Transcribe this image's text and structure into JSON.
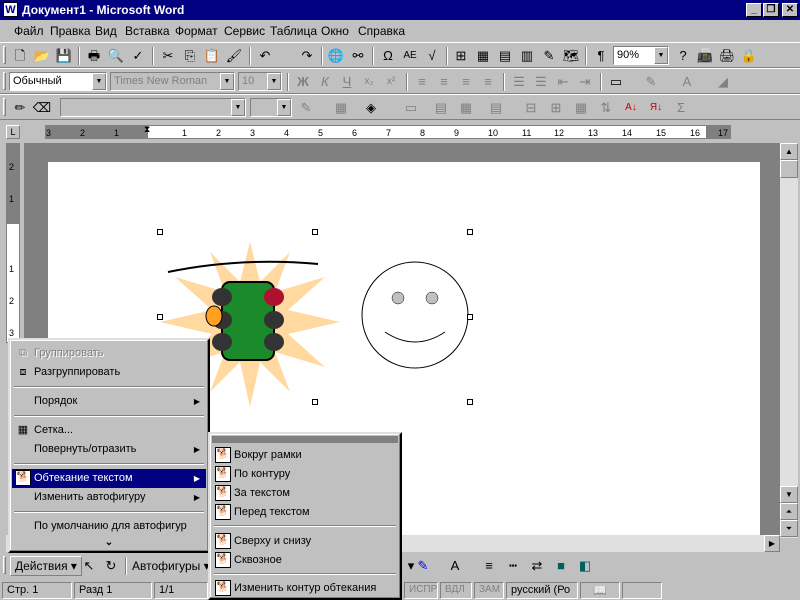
{
  "window": {
    "title": "Документ1 - Microsoft Word",
    "app_icon": "W"
  },
  "menubar": [
    "Файл",
    "Правка",
    "Вид",
    "Вставка",
    "Формат",
    "Сервис",
    "Таблица",
    "Окно",
    "Справка"
  ],
  "toolbar_standard": {
    "zoom": "90%"
  },
  "toolbar_format": {
    "style": "Обычный",
    "font": "Times New Roman",
    "size": "10"
  },
  "ruler": {
    "ticks": [
      "3",
      "2",
      "1",
      "1",
      "2",
      "3",
      "4",
      "5",
      "6",
      "7",
      "8",
      "9",
      "10",
      "11",
      "12",
      "13",
      "14",
      "15",
      "16",
      "17"
    ]
  },
  "vruler": {
    "ticks": [
      "2",
      "1",
      "1",
      "2",
      "3"
    ]
  },
  "actions_menu": {
    "items": [
      {
        "label": "Группировать",
        "state": "disabled"
      },
      {
        "label": "Разгруппировать",
        "state": "normal"
      },
      {
        "label": "Порядок",
        "state": "submenu"
      },
      {
        "label": "Сетка...",
        "state": "normal"
      },
      {
        "label": "Повернуть/отразить",
        "state": "submenu"
      },
      {
        "label": "Обтекание текстом",
        "state": "selected-submenu"
      },
      {
        "label": "Изменить автофигуру",
        "state": "submenu"
      },
      {
        "label": "По умолчанию для автофигур",
        "state": "normal"
      }
    ],
    "more": "⌄"
  },
  "wrap_submenu": {
    "items": [
      "Вокруг рамки",
      "По контуру",
      "За текстом",
      "Перед текстом",
      "Сверху и снизу",
      "Сквозное",
      "Изменить контур обтекания"
    ]
  },
  "drawing_toolbar": {
    "actions": "Действия",
    "autoshapes": "Автофигуры"
  },
  "statusbar": {
    "page": "Стр. 1",
    "section": "Разд 1",
    "pages": "1/1",
    "modes": [
      "ИСПР",
      "ВДЛ",
      "ЗАМ"
    ],
    "language": "русский (Ро"
  },
  "colors": {
    "title_bar": "#000080",
    "menu_highlight": "#000080",
    "face": "#c0c0c0"
  }
}
